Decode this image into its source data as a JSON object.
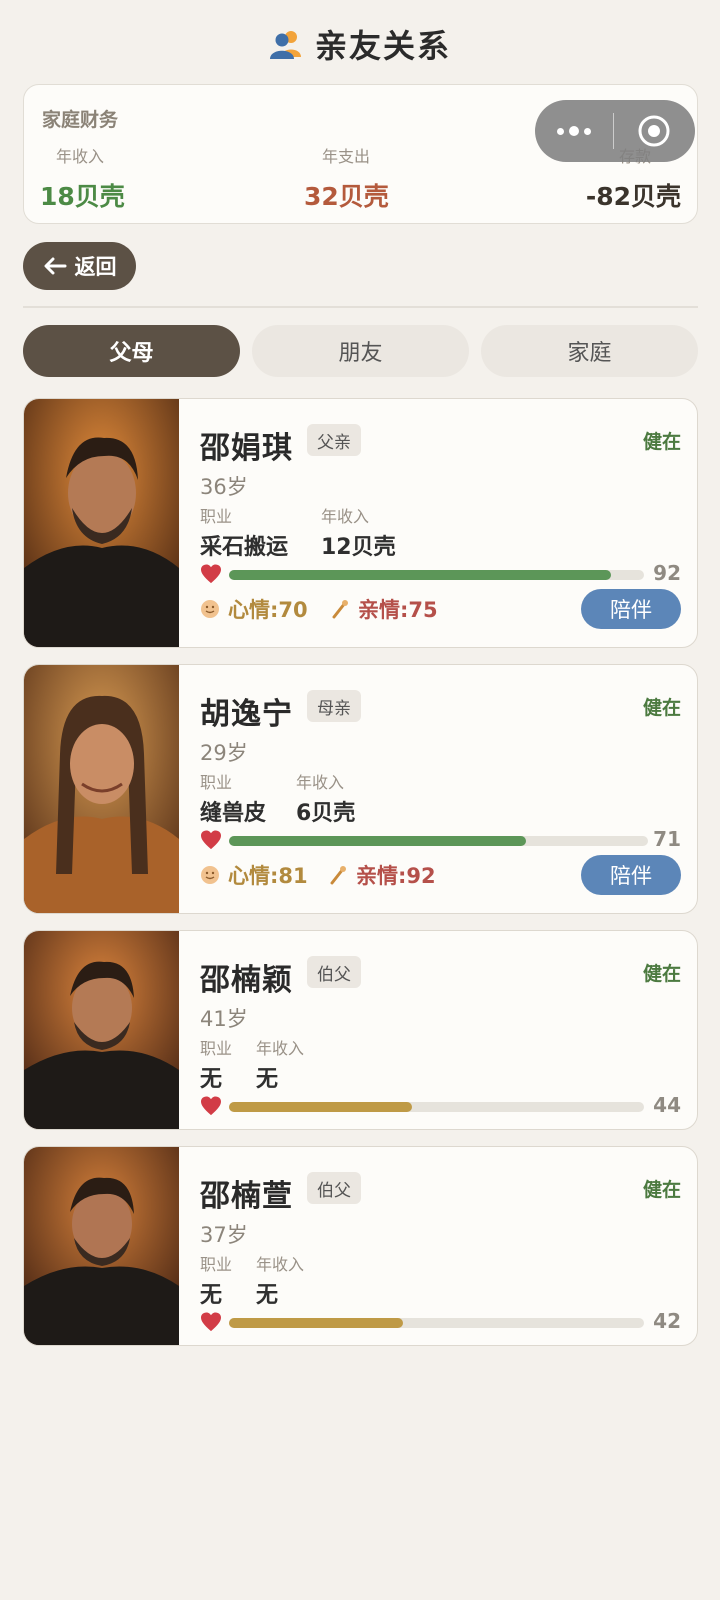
{
  "page": {
    "title": "亲友关系"
  },
  "finance": {
    "title": "家庭财务",
    "income_label": "年收入",
    "income_value": "18贝壳",
    "expense_label": "年支出",
    "expense_value": "32贝壳",
    "savings_label": "存款",
    "savings_value": "-82贝壳"
  },
  "back": {
    "label": "返回"
  },
  "tabs": [
    {
      "label": "父母",
      "active": true
    },
    {
      "label": "朋友",
      "active": false
    },
    {
      "label": "家庭",
      "active": false
    }
  ],
  "relatives": [
    {
      "name": "邵娟琪",
      "relation": "父亲",
      "status": "健在",
      "age": "36岁",
      "job_label": "职业",
      "income_label": "年收入",
      "job": "采石搬运",
      "income": "12贝壳",
      "health": 92,
      "health_color": "#5c9658",
      "mood": "心情:70",
      "affection": "亲情:75",
      "action": "陪伴"
    },
    {
      "name": "胡逸宁",
      "relation": "母亲",
      "status": "健在",
      "age": "29岁",
      "job_label": "职业",
      "income_label": "年收入",
      "job": "缝兽皮",
      "income": "6贝壳",
      "health": 71,
      "health_color": "#5c9658",
      "mood": "心情:81",
      "affection": "亲情:92",
      "action": "陪伴"
    },
    {
      "name": "邵楠颖",
      "relation": "伯父",
      "status": "健在",
      "age": "41岁",
      "job_label": "职业",
      "income_label": "年收入",
      "job": "无",
      "income": "无",
      "health": 44,
      "health_color": "#bf9a46"
    },
    {
      "name": "邵楠萱",
      "relation": "伯父",
      "status": "健在",
      "age": "37岁",
      "job_label": "职业",
      "income_label": "年收入",
      "job": "无",
      "income": "无",
      "health": 42,
      "health_color": "#bf9a46"
    }
  ],
  "colors": {
    "income": "#4c8a45",
    "expense": "#b45a3c",
    "savings": "#3b342c",
    "accent_dark": "#5c5145",
    "button_blue": "#5c86b8",
    "status_green": "#4c7a40"
  }
}
